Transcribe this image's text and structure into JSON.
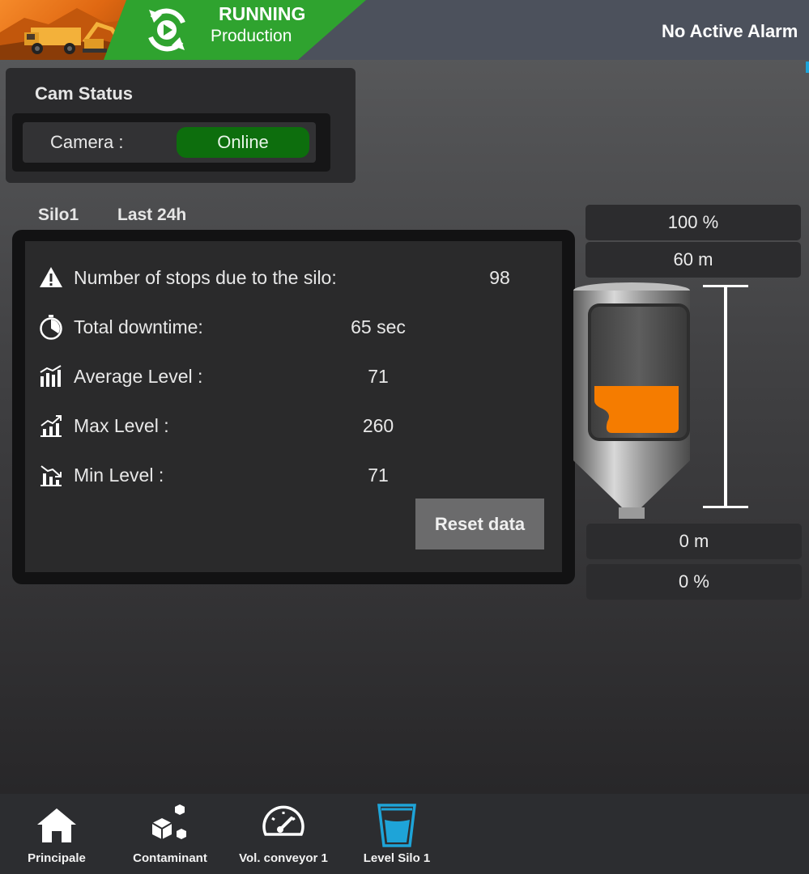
{
  "header": {
    "status_title": "RUNNING",
    "status_subtitle": "Production",
    "alarm_text": "No Active Alarm"
  },
  "cam_status": {
    "title": "Cam Status",
    "camera_label": "Camera :",
    "camera_state": "Online"
  },
  "silo": {
    "name": "Silo1",
    "period": "Last 24h",
    "stats": [
      {
        "icon": "warning-icon",
        "label": "Number of stops due to the silo:",
        "value": "98"
      },
      {
        "icon": "stopwatch-icon",
        "label": "Total downtime:",
        "value": "65 sec"
      },
      {
        "icon": "bar-chart-icon",
        "label": "Average Level :",
        "value": "71"
      },
      {
        "icon": "trend-up-chart-icon",
        "label": "Max Level :",
        "value": "260"
      },
      {
        "icon": "trend-down-chart-icon",
        "label": "Min Level :",
        "value": "71"
      }
    ],
    "reset_label": "Reset data"
  },
  "silo_display": {
    "top_percent": "100 %",
    "top_height": "60 m",
    "bottom_height": "0 m",
    "bottom_percent": "0 %",
    "fill_level": 0.28,
    "fill_color": "#f57c00"
  },
  "nav": {
    "items": [
      {
        "icon": "home-icon",
        "label": "Principale"
      },
      {
        "icon": "cubes-icon",
        "label": "Contaminant"
      },
      {
        "icon": "speedometer-icon",
        "label": "Vol. conveyor 1"
      },
      {
        "icon": "glass-level-icon",
        "label": "Level Silo 1"
      }
    ]
  },
  "colors": {
    "running_green": "#2fa32f",
    "online_green": "#0d6e0d",
    "accent_blue": "#1ea4d8"
  }
}
